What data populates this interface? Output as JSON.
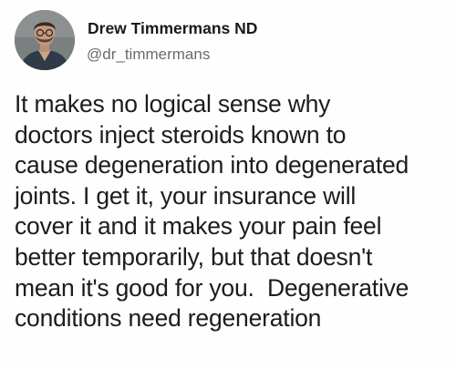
{
  "author": {
    "display_name": "Drew Timmermans ND",
    "handle": "@dr_timmermans",
    "avatar_icon": "profile-photo"
  },
  "tweet": {
    "lines": [
      "It makes no logical sense why",
      "doctors inject steroids known to",
      "cause degeneration into degenerated",
      "joints. I get it, your insurance will",
      "cover it and it makes your pain feel",
      "better temporarily, but that doesn't",
      "mean it's good for you.  Degenerative",
      "conditions need regeneration"
    ]
  }
}
